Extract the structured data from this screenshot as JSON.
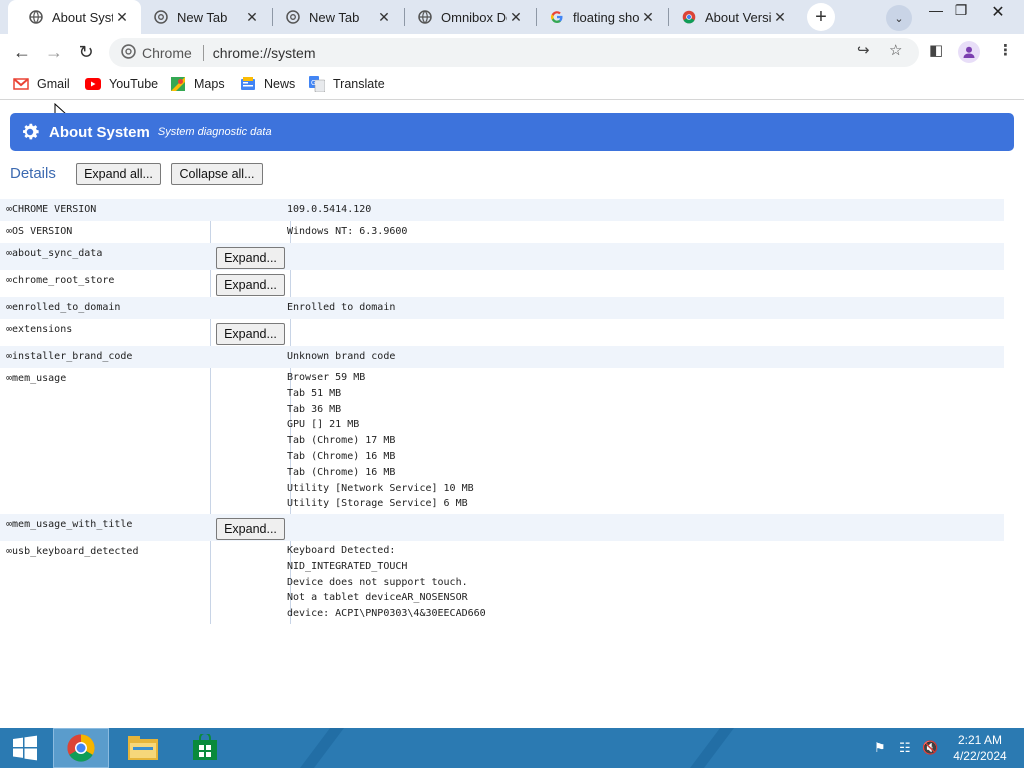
{
  "browser": {
    "tabs": [
      {
        "title": "About System",
        "active": true,
        "favicon": "globe-icon"
      },
      {
        "title": "New Tab",
        "active": false,
        "favicon": "chrome-outline-icon"
      },
      {
        "title": "New Tab",
        "active": false,
        "favicon": "chrome-outline-icon"
      },
      {
        "title": "Omnibox Debug",
        "active": false,
        "favicon": "globe-icon"
      },
      {
        "title": "floating shop",
        "active": false,
        "favicon": "google-icon"
      },
      {
        "title": "About Version",
        "active": false,
        "favicon": "chrome-icon"
      }
    ],
    "new_tab_symbol": "+",
    "omnibox": {
      "chip_label": "Chrome",
      "url": "chrome://system"
    },
    "bookmarks": [
      {
        "label": "Gmail",
        "icon": "gmail-icon"
      },
      {
        "label": "YouTube",
        "icon": "youtube-icon"
      },
      {
        "label": "Maps",
        "icon": "maps-icon"
      },
      {
        "label": "News",
        "icon": "news-icon"
      },
      {
        "label": "Translate",
        "icon": "translate-icon"
      }
    ]
  },
  "page": {
    "title": "About System",
    "subtitle": "System diagnostic data",
    "details_label": "Details",
    "expand_all_label": "Expand all...",
    "collapse_all_label": "Collapse all...",
    "expand_label": "Expand...",
    "rows": [
      {
        "name": "CHROME VERSION",
        "value": "109.0.5414.120",
        "has_expand": false
      },
      {
        "name": "OS VERSION",
        "value": "Windows NT: 6.3.9600",
        "has_expand": false
      },
      {
        "name": "about_sync_data",
        "value": "",
        "has_expand": true
      },
      {
        "name": "chrome_root_store",
        "value": "",
        "has_expand": true
      },
      {
        "name": "enrolled_to_domain",
        "value": "Enrolled to domain",
        "has_expand": false
      },
      {
        "name": "extensions",
        "value": "",
        "has_expand": true
      },
      {
        "name": "installer_brand_code",
        "value": "Unknown brand code",
        "has_expand": false
      },
      {
        "name": "mem_usage",
        "value": "Browser 59 MB\nTab 51 MB\nTab 36 MB\nGPU [] 21 MB\nTab (Chrome) 17 MB\nTab (Chrome) 16 MB\nTab (Chrome) 16 MB\nUtility [Network Service] 10 MB\nUtility [Storage Service] 6 MB",
        "has_expand": false
      },
      {
        "name": "mem_usage_with_title",
        "value": "",
        "has_expand": true
      },
      {
        "name": "usb_keyboard_detected",
        "value": "Keyboard Detected:\nNID_INTEGRATED_TOUCH\nDevice does not support touch.\nNot a tablet deviceAR_NOSENSOR\ndevice: ACPI\\PNP0303\\4&30EECAD660",
        "has_expand": false
      }
    ]
  },
  "taskbar": {
    "time": "2:21 AM",
    "date": "4/22/2024",
    "pinned": [
      "start-button",
      "chrome-app",
      "file-explorer-app",
      "store-app"
    ],
    "tray_icons": [
      "flag-icon",
      "network-icon",
      "volume-muted-icon"
    ],
    "color": "#2b7ab2"
  },
  "colors": {
    "banner": "#3d73dc",
    "tabstrip": "#dfe6f1",
    "row_shade": "#eff4fb"
  }
}
